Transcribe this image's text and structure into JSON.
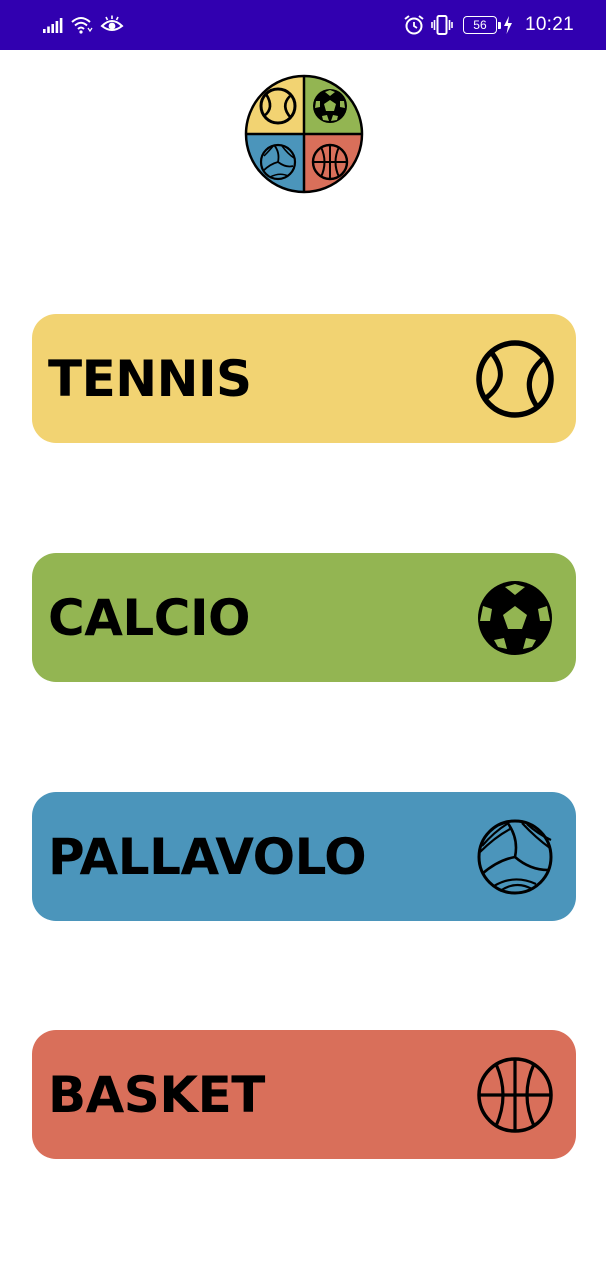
{
  "status_bar": {
    "battery_level": "56",
    "time": "10:21",
    "icons": [
      "signal-icon",
      "wifi-icon",
      "eye-icon",
      "alarm-icon",
      "vibrate-icon",
      "battery-icon",
      "charging-icon"
    ]
  },
  "logo": {
    "icon": "sports-balls-logo-icon"
  },
  "sports": [
    {
      "label": "TENNIS",
      "color": "#f2d372",
      "icon": "tennis-ball-icon"
    },
    {
      "label": "CALCIO",
      "color": "#93b552",
      "icon": "soccer-ball-icon"
    },
    {
      "label": "PALLAVOLO",
      "color": "#4b95bb",
      "icon": "volleyball-icon"
    },
    {
      "label": "BASKET",
      "color": "#d96f5a",
      "icon": "basketball-icon"
    }
  ]
}
